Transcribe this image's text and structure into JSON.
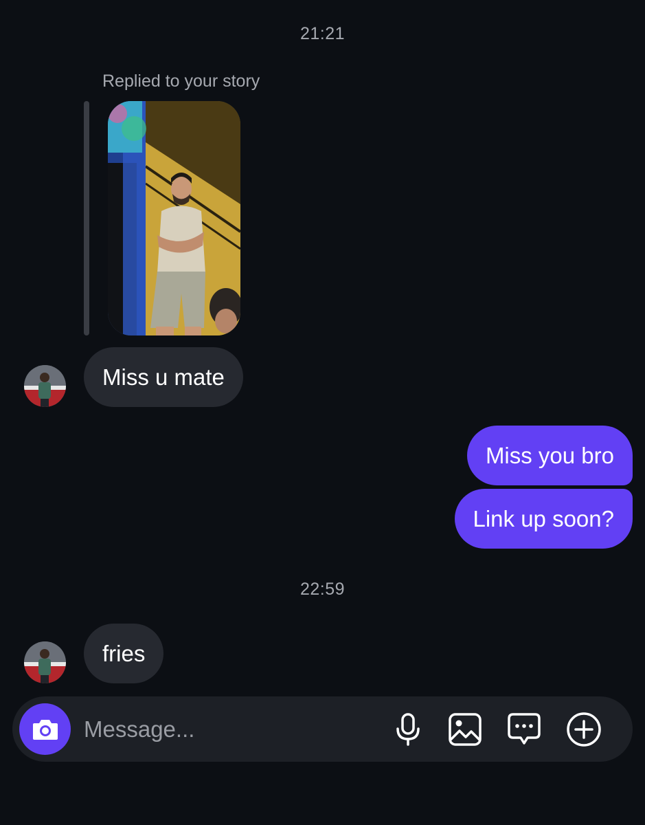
{
  "conversation": {
    "first_timestamp": "21:21",
    "story_reply": {
      "caption": "Replied to your story",
      "thumbnail": "story-photo-man-on-stairs"
    },
    "messages_block_1": [
      {
        "from": "them",
        "text": "Miss u mate"
      },
      {
        "from": "me",
        "text": "Miss you bro"
      },
      {
        "from": "me",
        "text": "Link up soon?"
      }
    ],
    "second_timestamp": "22:59",
    "messages_block_2": [
      {
        "from": "them",
        "text": "fries"
      }
    ]
  },
  "composer": {
    "placeholder": "Message...",
    "value": "",
    "icons": [
      "camera-icon",
      "microphone-icon",
      "gallery-icon",
      "sticker-chat-icon",
      "add-icon"
    ]
  },
  "colors": {
    "background": "#0c0f14",
    "incoming_bubble": "#262930",
    "outgoing_bubble": "#6240f4",
    "muted_text": "#a6a9b0"
  }
}
